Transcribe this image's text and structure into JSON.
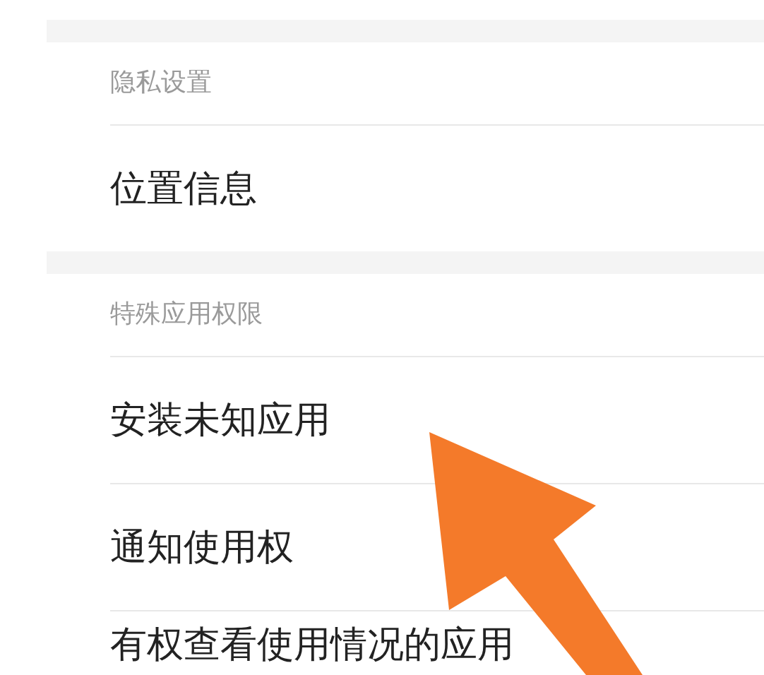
{
  "sections": [
    {
      "header": "隐私设置",
      "items": [
        "位置信息"
      ]
    },
    {
      "header": "特殊应用权限",
      "items": [
        "安装未知应用",
        "通知使用权",
        "有权查看使用情况的应用"
      ]
    }
  ]
}
